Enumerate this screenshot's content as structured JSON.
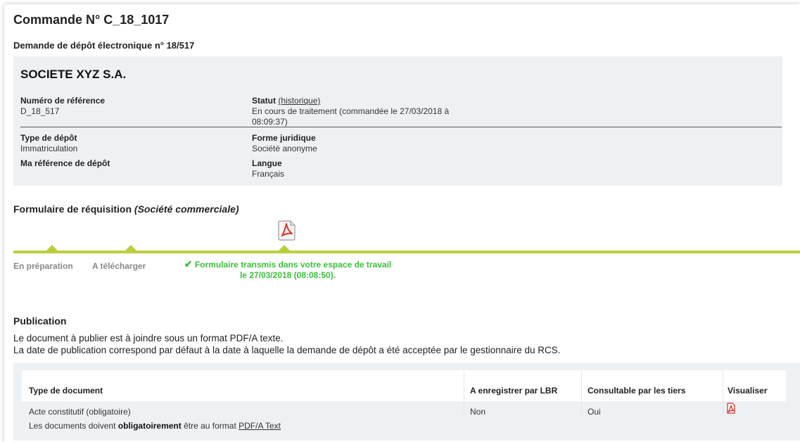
{
  "header": {
    "order_title": "Commande N° C_18_1017",
    "request_title": "Demande de dépôt électronique n° 18/517"
  },
  "company": {
    "name": "SOCIETE XYZ S.A.",
    "ref_label": "Numéro de référence",
    "ref_value": "D_18_517",
    "status_label": "Statut",
    "status_link": "(historique)",
    "status_value": "En cours de traitement (commandée le 27/03/2018 à 08:09:37)",
    "type_label": "Type de dépôt",
    "type_value": "Immatriculation",
    "myref_label": "Ma référence de dépôt",
    "legal_label": "Forme juridique",
    "legal_value": "Société anonyme",
    "lang_label": "Langue",
    "lang_value": "Français"
  },
  "form": {
    "title": "Formulaire de réquisition ",
    "title_italic": "(Société commerciale)",
    "pdf_icon": "pdf-icon",
    "steps": [
      "En préparation",
      "A télécharger"
    ],
    "done_line1": "Formulaire transmis dans votre espace de travail",
    "done_line2": "le 27/03/2018 (08:08:50).",
    "track_color": "#b8cf3a",
    "done_color": "#3bbf3b"
  },
  "publication": {
    "title": "Publication",
    "line1": "Le document à publier est à joindre sous un format PDF/A texte.",
    "line2": "La date de publication correspond par défaut à la date à laquelle la demande de dépôt a été acceptée par le gestionnaire du RCS.",
    "columns": [
      "Type de document",
      "A enregistrer par LBR",
      "Consultable par les tiers",
      "Visualiser"
    ],
    "rows": [
      {
        "type": "Acte constitutif (obligatoire)",
        "lbr": "Non",
        "tiers": "Oui",
        "view_icon": "pdf-icon"
      }
    ],
    "note_prefix": "Les documents doivent ",
    "note_bold": "obligatoirement",
    "note_middle": " être au format ",
    "note_link": "PDF/A Text"
  }
}
